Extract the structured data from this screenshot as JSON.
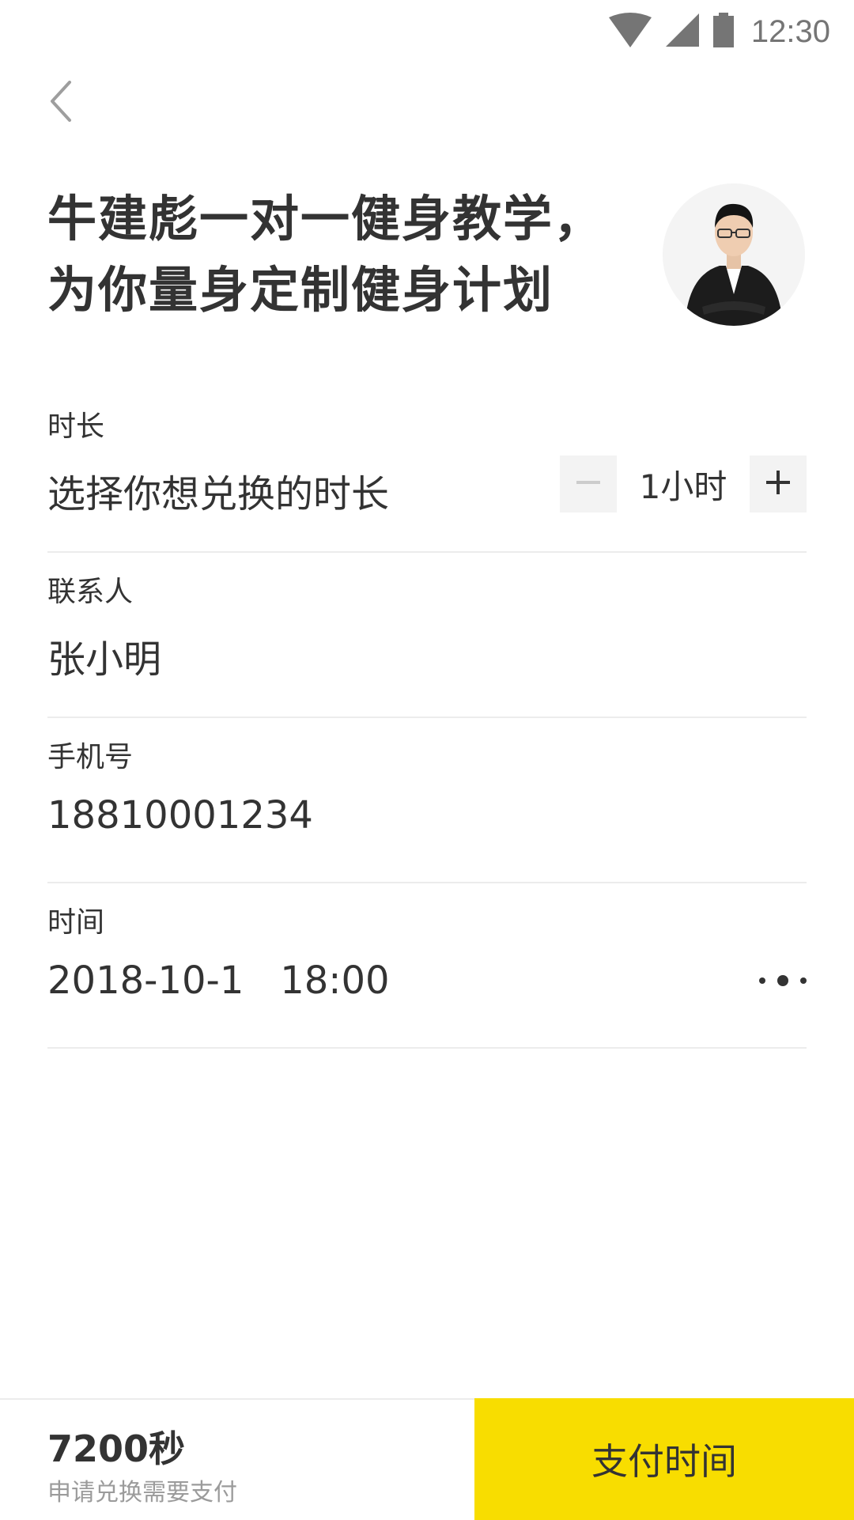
{
  "status_bar": {
    "time": "12:30",
    "icons": [
      "wifi-icon",
      "signal-icon",
      "battery-icon"
    ]
  },
  "header": {
    "back_icon": "chevron-left-icon",
    "title_line1": "牛建彪一对一健身教学，",
    "title_line2": "为你量身定制健身计划"
  },
  "form": {
    "duration": {
      "label": "时长",
      "value": "选择你想兑换的时长",
      "stepper_value": "1小时",
      "minus_icon": "minus-icon",
      "plus_icon": "plus-icon"
    },
    "contact": {
      "label": "联系人",
      "value": "张小明"
    },
    "phone": {
      "label": "手机号",
      "value": "18810001234"
    },
    "time": {
      "label": "时间",
      "value": "2018-10-1   18:00",
      "more_icon": "more-icon"
    }
  },
  "footer": {
    "price": "7200秒",
    "price_note": "申请兑换需要支付",
    "pay_button": "支付时间"
  },
  "colors": {
    "accent": "#f8dd00",
    "text": "#333333",
    "muted": "#9b9b9b",
    "divider": "#ececec"
  }
}
